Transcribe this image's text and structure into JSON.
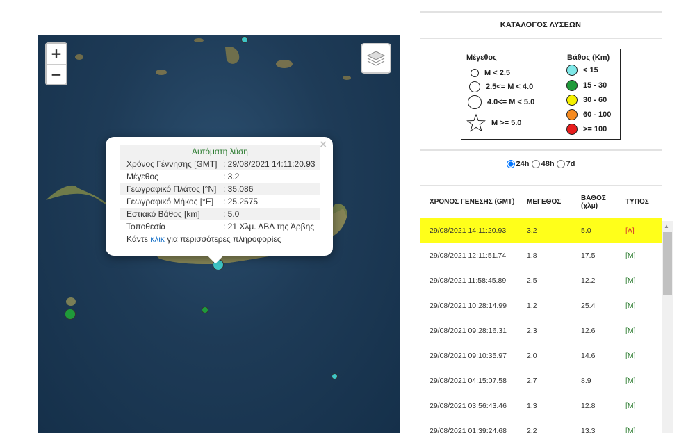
{
  "map": {
    "zoom_in": "+",
    "zoom_out": "−",
    "popup": {
      "close": "×",
      "title": "Αυτόματη λύση",
      "rows": [
        {
          "k": "Χρόνος Γέννησης [GMT]",
          "v": ": 29/08/2021 14:11:20.93"
        },
        {
          "k": "Μέγεθος",
          "v": ": 3.2"
        },
        {
          "k": "Γεωγραφικό Πλάτος [°N]",
          "v": ": 35.086"
        },
        {
          "k": "Γεωγραφικό Μήκος [°E]",
          "v": ": 25.2575"
        },
        {
          "k": "Εστιακό Βάθος [km]",
          "v": ": 5.0"
        },
        {
          "k": "Τοποθεσία",
          "v": ": 21 Χλμ. ΔΒΔ της Άρβης"
        }
      ],
      "foot_pre": "Κάντε ",
      "foot_link": "κλικ",
      "foot_post": " για περισσότερες πληροφορίες"
    }
  },
  "panel": {
    "title": "ΚΑΤΑΛΟΓΟΣ ΛΥΣΕΩΝ",
    "legend": {
      "mag_title": "Μέγεθος",
      "depth_title": "Βάθος (Km)",
      "mags": [
        "M < 2.5",
        "2.5<= M < 4.0",
        "4.0<= M < 5.0",
        "M >= 5.0"
      ],
      "depths": [
        {
          "label": "< 15",
          "color": "#7fe8e8"
        },
        {
          "label": "15 - 30",
          "color": "#1f9a3a"
        },
        {
          "label": "30 - 60",
          "color": "#f5f000"
        },
        {
          "label": "60 - 100",
          "color": "#f58a1f"
        },
        {
          "label": ">= 100",
          "color": "#e81d1d"
        }
      ]
    },
    "filters": [
      "24h",
      "48h",
      "7d"
    ],
    "table": {
      "headers": [
        "ΧΡΟΝΟΣ ΓΕΝΕΣΗΣ (GMT)",
        "ΜΕΓΕΘΟΣ",
        "ΒΑΘΟΣ (χλμ)",
        "ΤΥΠΟΣ"
      ],
      "rows": [
        {
          "time": "29/08/2021 14:11:20.93",
          "mag": "3.2",
          "depth": "5.0",
          "type": "[A]"
        },
        {
          "time": "29/08/2021 12:11:51.74",
          "mag": "1.8",
          "depth": "17.5",
          "type": "[M]"
        },
        {
          "time": "29/08/2021 11:58:45.89",
          "mag": "2.5",
          "depth": "12.2",
          "type": "[M]"
        },
        {
          "time": "29/08/2021 10:28:14.99",
          "mag": "1.2",
          "depth": "25.4",
          "type": "[M]"
        },
        {
          "time": "29/08/2021 09:28:16.31",
          "mag": "2.3",
          "depth": "12.6",
          "type": "[M]"
        },
        {
          "time": "29/08/2021 09:10:35.97",
          "mag": "2.0",
          "depth": "14.6",
          "type": "[M]"
        },
        {
          "time": "29/08/2021 04:15:07.58",
          "mag": "2.7",
          "depth": "8.9",
          "type": "[M]"
        },
        {
          "time": "29/08/2021 03:56:43.46",
          "mag": "1.3",
          "depth": "12.8",
          "type": "[M]"
        },
        {
          "time": "29/08/2021 01:39:24.68",
          "mag": "2.2",
          "depth": "13.3",
          "type": "[M]"
        }
      ]
    }
  }
}
